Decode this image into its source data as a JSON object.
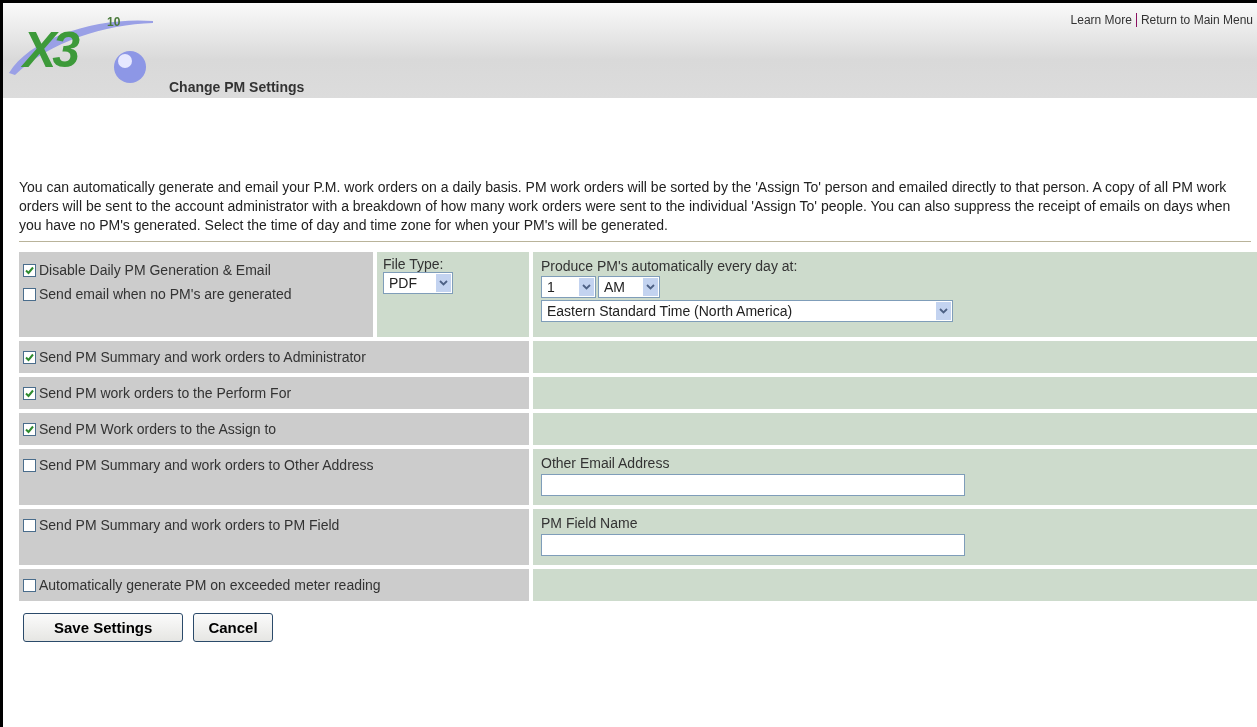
{
  "header": {
    "logo": {
      "text": "X3",
      "superscript": "10"
    },
    "title": "Change PM Settings",
    "links": [
      {
        "label": "Learn More"
      },
      {
        "label": "Return to Main Menu"
      }
    ]
  },
  "intro": "You can automatically generate and email your P.M. work orders on a daily basis. PM work orders will be sorted by the 'Assign To' person and emailed directly to that person. A copy of all PM work orders will be sent to the account administrator with a breakdown of how many work orders were sent to the individual 'Assign To' people. You can also suppress the receipt of emails on days when you have no PM's generated. Select the time of day and time zone for when your PM's will be generated.",
  "schedule": {
    "options": [
      {
        "label": "Disable Daily PM Generation & Email",
        "checked": true
      },
      {
        "label": "Send email when no PM's are generated",
        "checked": false
      }
    ],
    "file_type": {
      "label": "File Type:",
      "value": "PDF"
    },
    "time": {
      "label": "Produce PM's automatically every day at:",
      "hour": "1",
      "meridiem": "AM",
      "time_zone": "Eastern Standard Time (North America)"
    }
  },
  "rows": [
    {
      "kind": "plain",
      "label": "Send PM Summary and work orders to Administrator",
      "checked": true
    },
    {
      "kind": "plain",
      "label": "Send PM work orders to the Perform For",
      "checked": true
    },
    {
      "kind": "plain",
      "label": "Send PM Work orders to the Assign to",
      "checked": true
    },
    {
      "kind": "field",
      "label": "Send PM Summary and work orders to Other Address",
      "checked": false,
      "field_label": "Other Email Address"
    },
    {
      "kind": "field",
      "label": "Send PM Summary and work orders to PM Field",
      "checked": false,
      "field_label": "PM Field Name"
    },
    {
      "kind": "plain",
      "label": "Automatically generate PM on exceeded meter reading",
      "checked": false
    }
  ],
  "buttons": [
    {
      "label": "Save Settings"
    },
    {
      "label": "Cancel"
    }
  ]
}
